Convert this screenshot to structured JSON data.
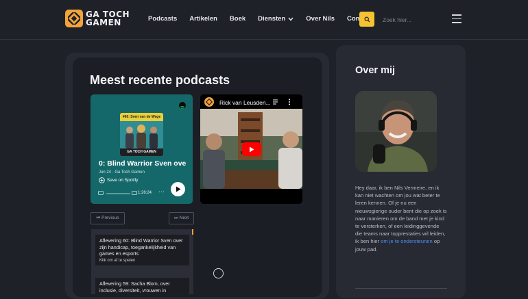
{
  "brand": {
    "name_line1": "GA TOCH",
    "name_line2": "GAMEN",
    "accent": "#f2a33a"
  },
  "nav": {
    "items": [
      "Podcasts",
      "Artikelen",
      "Boek",
      "Diensten",
      "Over Nils",
      "Contact"
    ],
    "search_placeholder": "Zoek hier...",
    "search_button_color": "#f5c332"
  },
  "podcasts": {
    "title": "Meest recente podcasts",
    "spotify": {
      "cover_band": "#60: Sven van de Wege",
      "cover_footer": "GA TOCH GAMEN",
      "episode_title": "0: Blind Warrior Sven ove",
      "meta": "Jun 24 · Ga Toch Gamen",
      "save_label": "Save on Spotify",
      "duration": "1:26:24",
      "more": "···"
    },
    "youtube": {
      "video_title": "Rick van Leusden..."
    },
    "pager": {
      "previous": "⏮ Previous",
      "next": "⏭ Next"
    },
    "episodes": [
      {
        "title": "Aflevering 60: Blind Warrior Sven over zijn handicap, toegankelijkheid van games en esports",
        "subtitle": "Klik om af te spelen"
      },
      {
        "title": "Aflevering 59: Sacha Blom, over inclusie, diversiteit, vrouwen in",
        "subtitle": ""
      }
    ]
  },
  "about": {
    "title": "Over mij",
    "text_before_link": "Hey daar, ik ben Nils Vermeire, en ik kan niet wachten om jou wat beter te leren kennen. Of je nu een nieuwsgierige ouder bent die op zoek is naar manieren om de band met je kind te versterken, of een leidinggevende die teams naar topprestaties wil leiden, ik ben hier ",
    "link_text": "om je te ondersteunen",
    "text_after_link": " op jouw pad."
  }
}
